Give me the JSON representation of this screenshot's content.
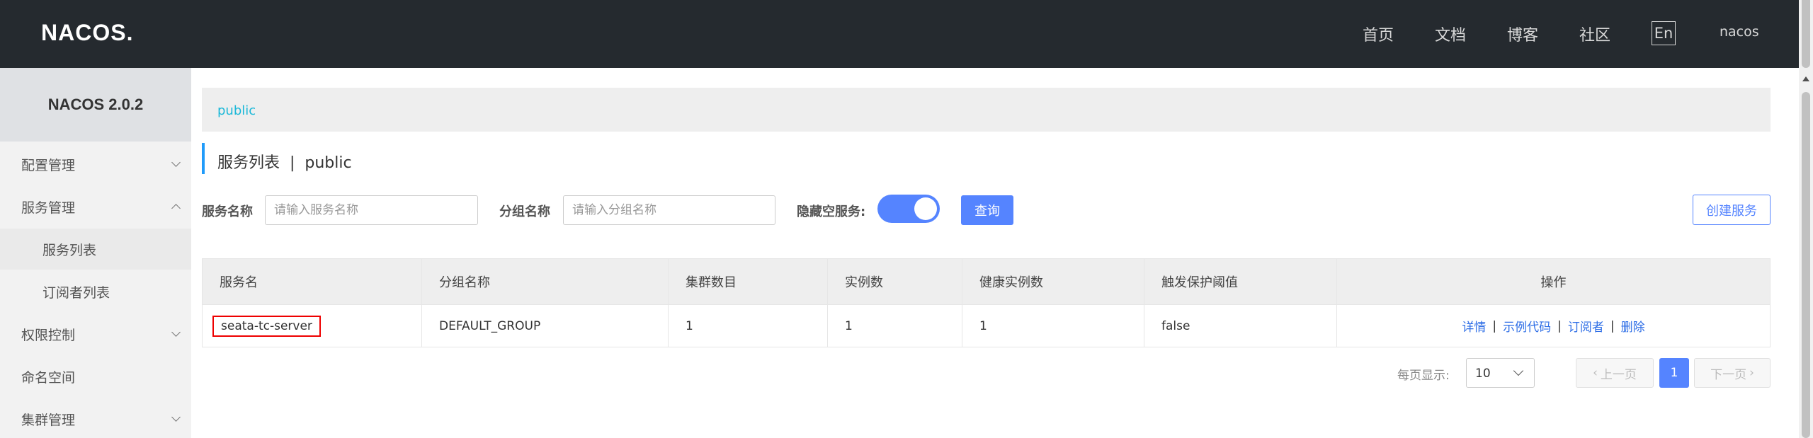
{
  "header": {
    "logo": "NACOS.",
    "nav": [
      "首页",
      "文档",
      "博客",
      "社区"
    ],
    "lang": "En",
    "user": "nacos"
  },
  "sidebar": {
    "title": "NACOS 2.0.2",
    "items": [
      {
        "label": "配置管理",
        "expandable": true,
        "expanded": false
      },
      {
        "label": "服务管理",
        "expandable": true,
        "expanded": true
      },
      {
        "label": "服务列表",
        "sub": true,
        "active": true
      },
      {
        "label": "订阅者列表",
        "sub": true
      },
      {
        "label": "权限控制",
        "expandable": true,
        "expanded": false
      },
      {
        "label": "命名空间"
      },
      {
        "label": "集群管理",
        "expandable": true,
        "expanded": false
      }
    ]
  },
  "breadcrumb": "public",
  "page_title": "服务列表  |  public",
  "filters": {
    "service_name_label": "服务名称",
    "service_name_placeholder": "请输入服务名称",
    "group_name_label": "分组名称",
    "group_name_placeholder": "请输入分组名称",
    "hide_empty_label": "隐藏空服务:",
    "hide_empty_on": true,
    "search_button": "查询",
    "create_button": "创建服务"
  },
  "table": {
    "columns": [
      "服务名",
      "分组名称",
      "集群数目",
      "实例数",
      "健康实例数",
      "触发保护阈值",
      "操作"
    ],
    "rows": [
      {
        "service": "seata-tc-server",
        "group": "DEFAULT_GROUP",
        "clusters": "1",
        "instances": "1",
        "healthy": "1",
        "threshold": "false",
        "actions": [
          "详情",
          "示例代码",
          "订阅者",
          "删除"
        ]
      }
    ]
  },
  "pagination": {
    "page_size_label": "每页显示:",
    "page_size": "10",
    "prev": "上一页",
    "next": "下一页",
    "current_page": "1"
  },
  "colors": {
    "primary": "#5584ff",
    "topbar": "#252a2f",
    "accent": "#1ab8d8",
    "highlight_border": "#ee0000"
  }
}
